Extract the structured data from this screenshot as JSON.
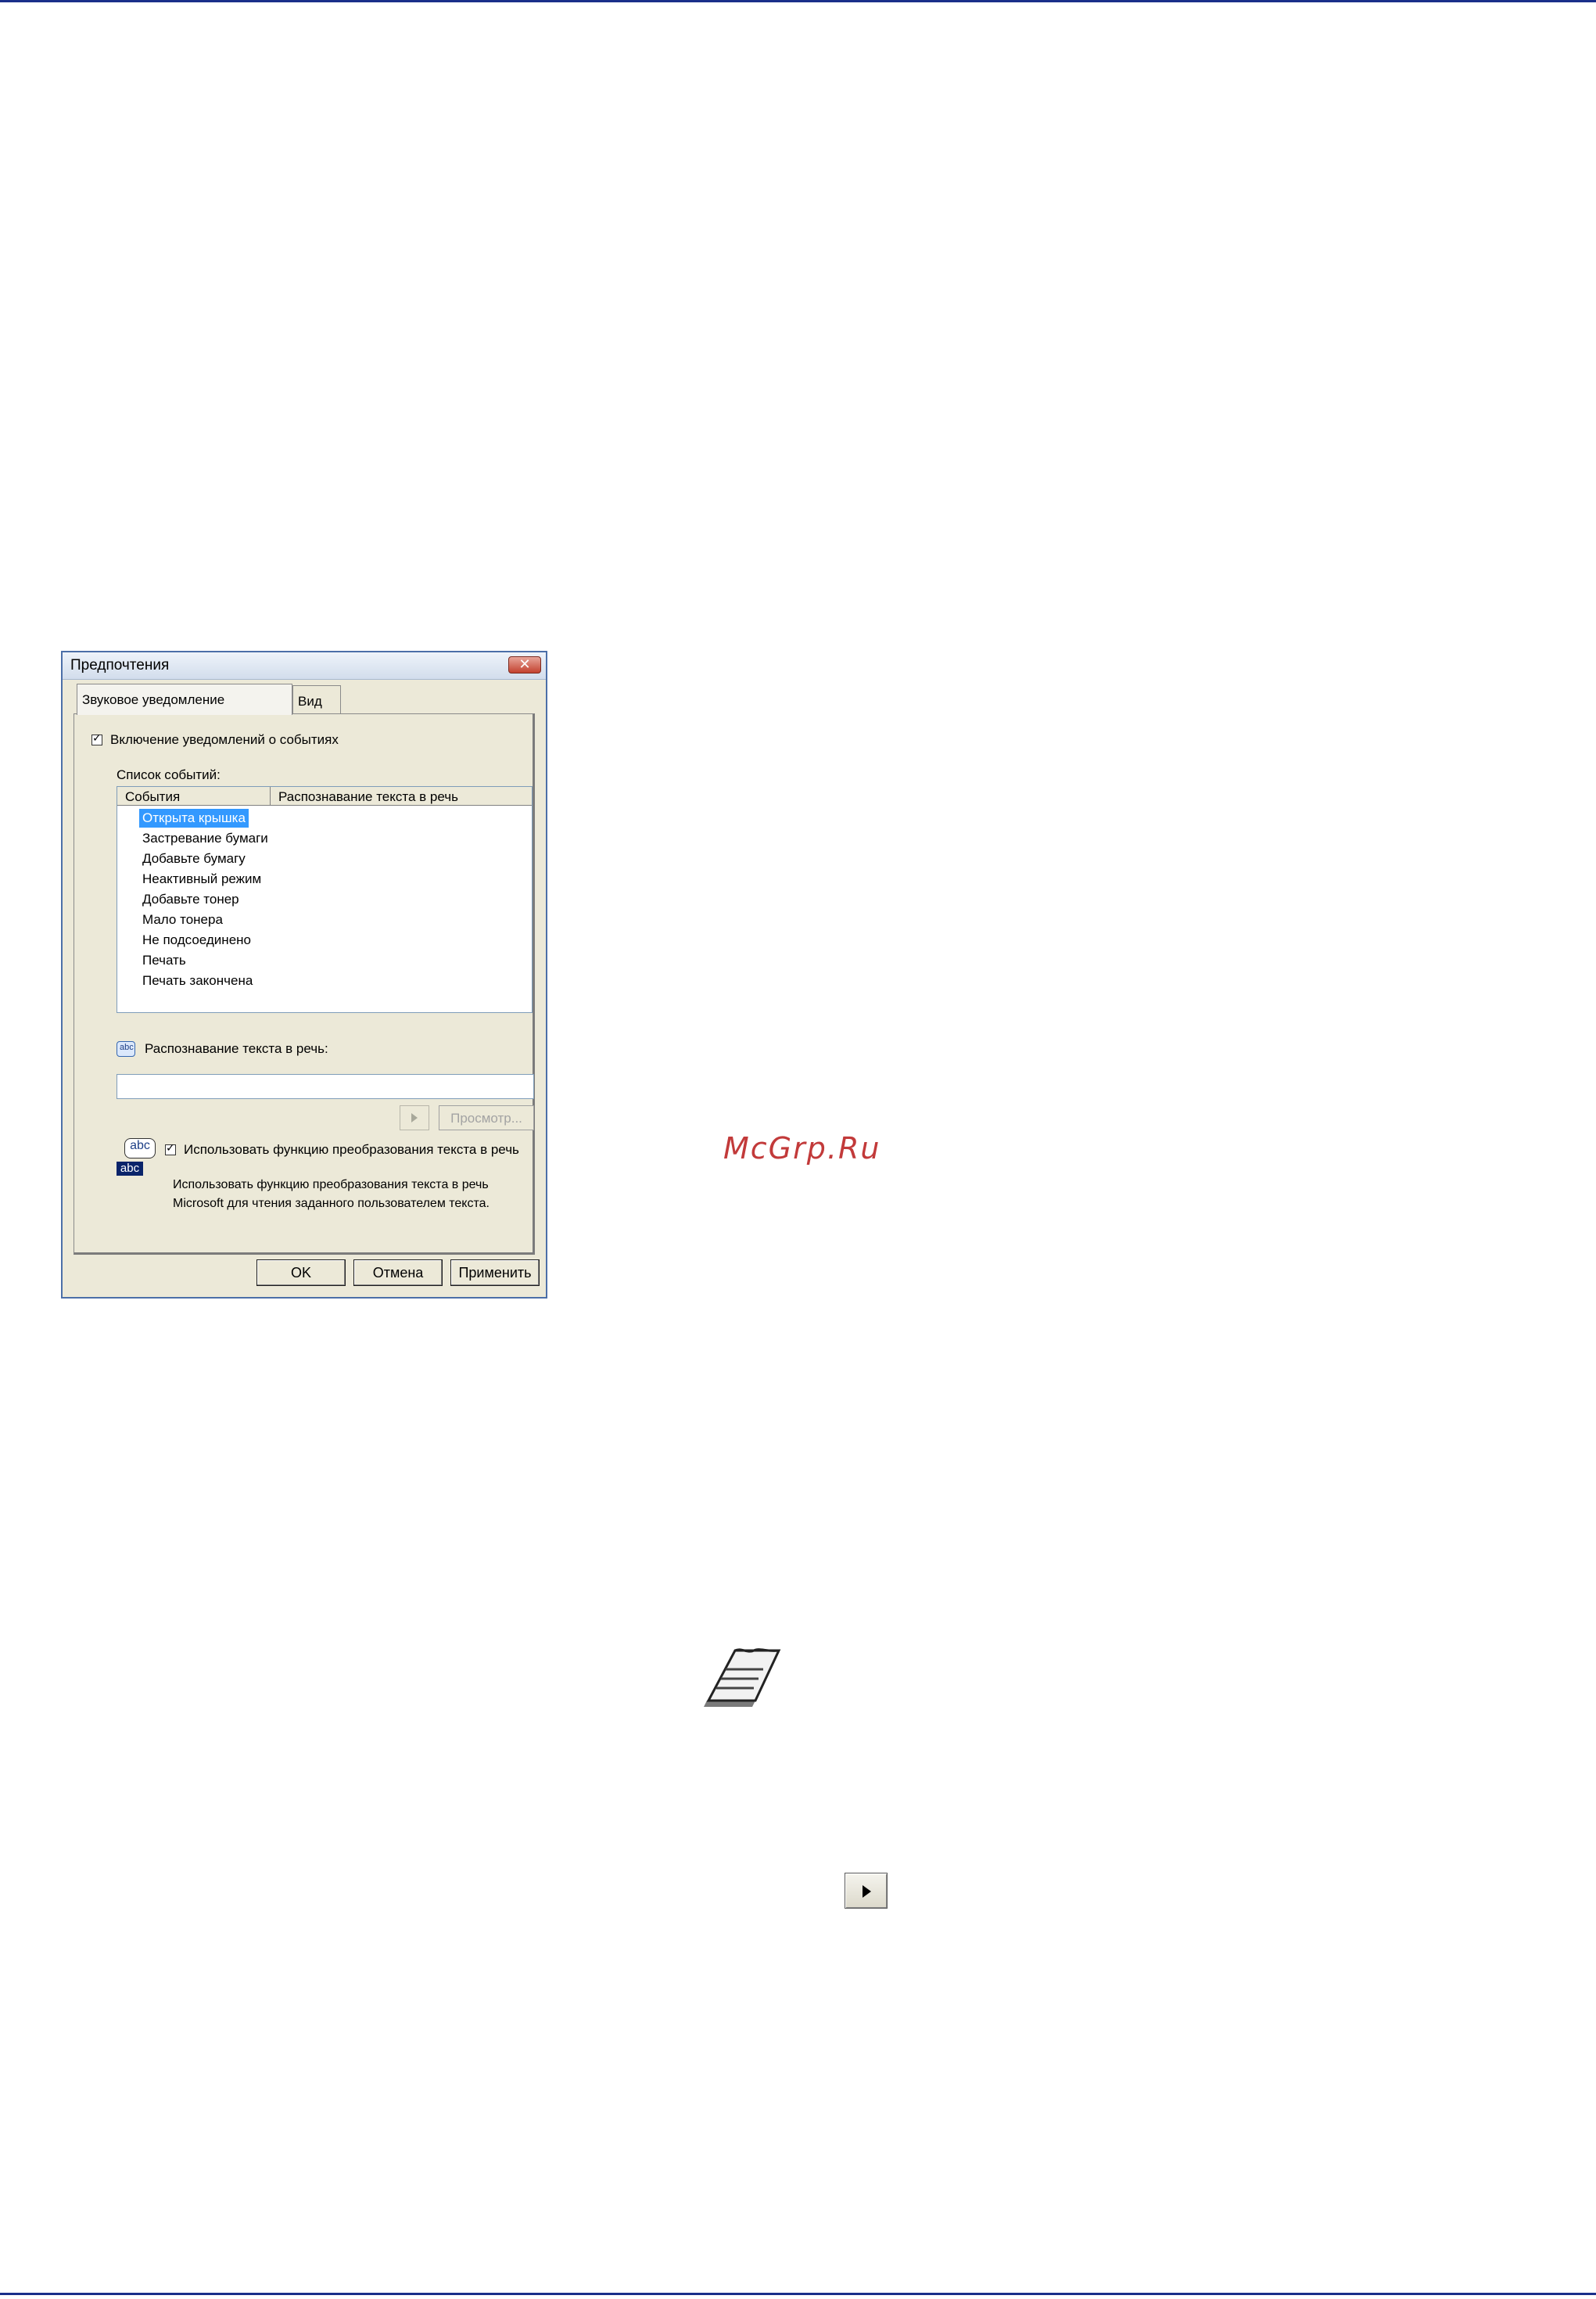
{
  "dialog": {
    "title": "Предпочтения",
    "close_symbol": "✕",
    "tabs": [
      {
        "label": "Звуковое уведомление",
        "active": true
      },
      {
        "label": "Вид",
        "active": false
      }
    ],
    "enable_notifications": {
      "label": "Включение уведомлений о событиях",
      "checked": true
    },
    "event_list": {
      "label": "Список событий:",
      "columns": [
        "События",
        "Распознавание текста в речь"
      ],
      "items": [
        "Открыта крышка",
        "Застревание бумаги",
        "Добавьте бумагу",
        "Неактивный режим",
        "Добавьте тонер",
        "Мало тонера",
        "Не подсоединено",
        "Печать",
        "Печать закончена"
      ],
      "selected_index": 0
    },
    "tts_label": "Распознавание текста в речь:",
    "tts_value": "",
    "preview_button": "Просмотр...",
    "use_tts": {
      "label": "Использовать функцию преобразования текста в речь",
      "checked": true
    },
    "description": [
      "Использовать функцию преобразования текста в речь",
      "Microsoft для чтения заданного пользователем текста."
    ],
    "abc_icon_text": {
      "top": "abc",
      "bottom": "abc"
    },
    "speech_icon_text": "abc",
    "buttons": {
      "ok": "OK",
      "cancel": "Отмена",
      "apply": "Применить"
    }
  },
  "watermark": "McGrp.Ru",
  "colors": {
    "rule": "#1a2f8a",
    "selection": "#3399ff",
    "watermark": "#c23a3a"
  },
  "icons": {
    "note": "note-page-icon",
    "play": "play-triangle-icon"
  }
}
